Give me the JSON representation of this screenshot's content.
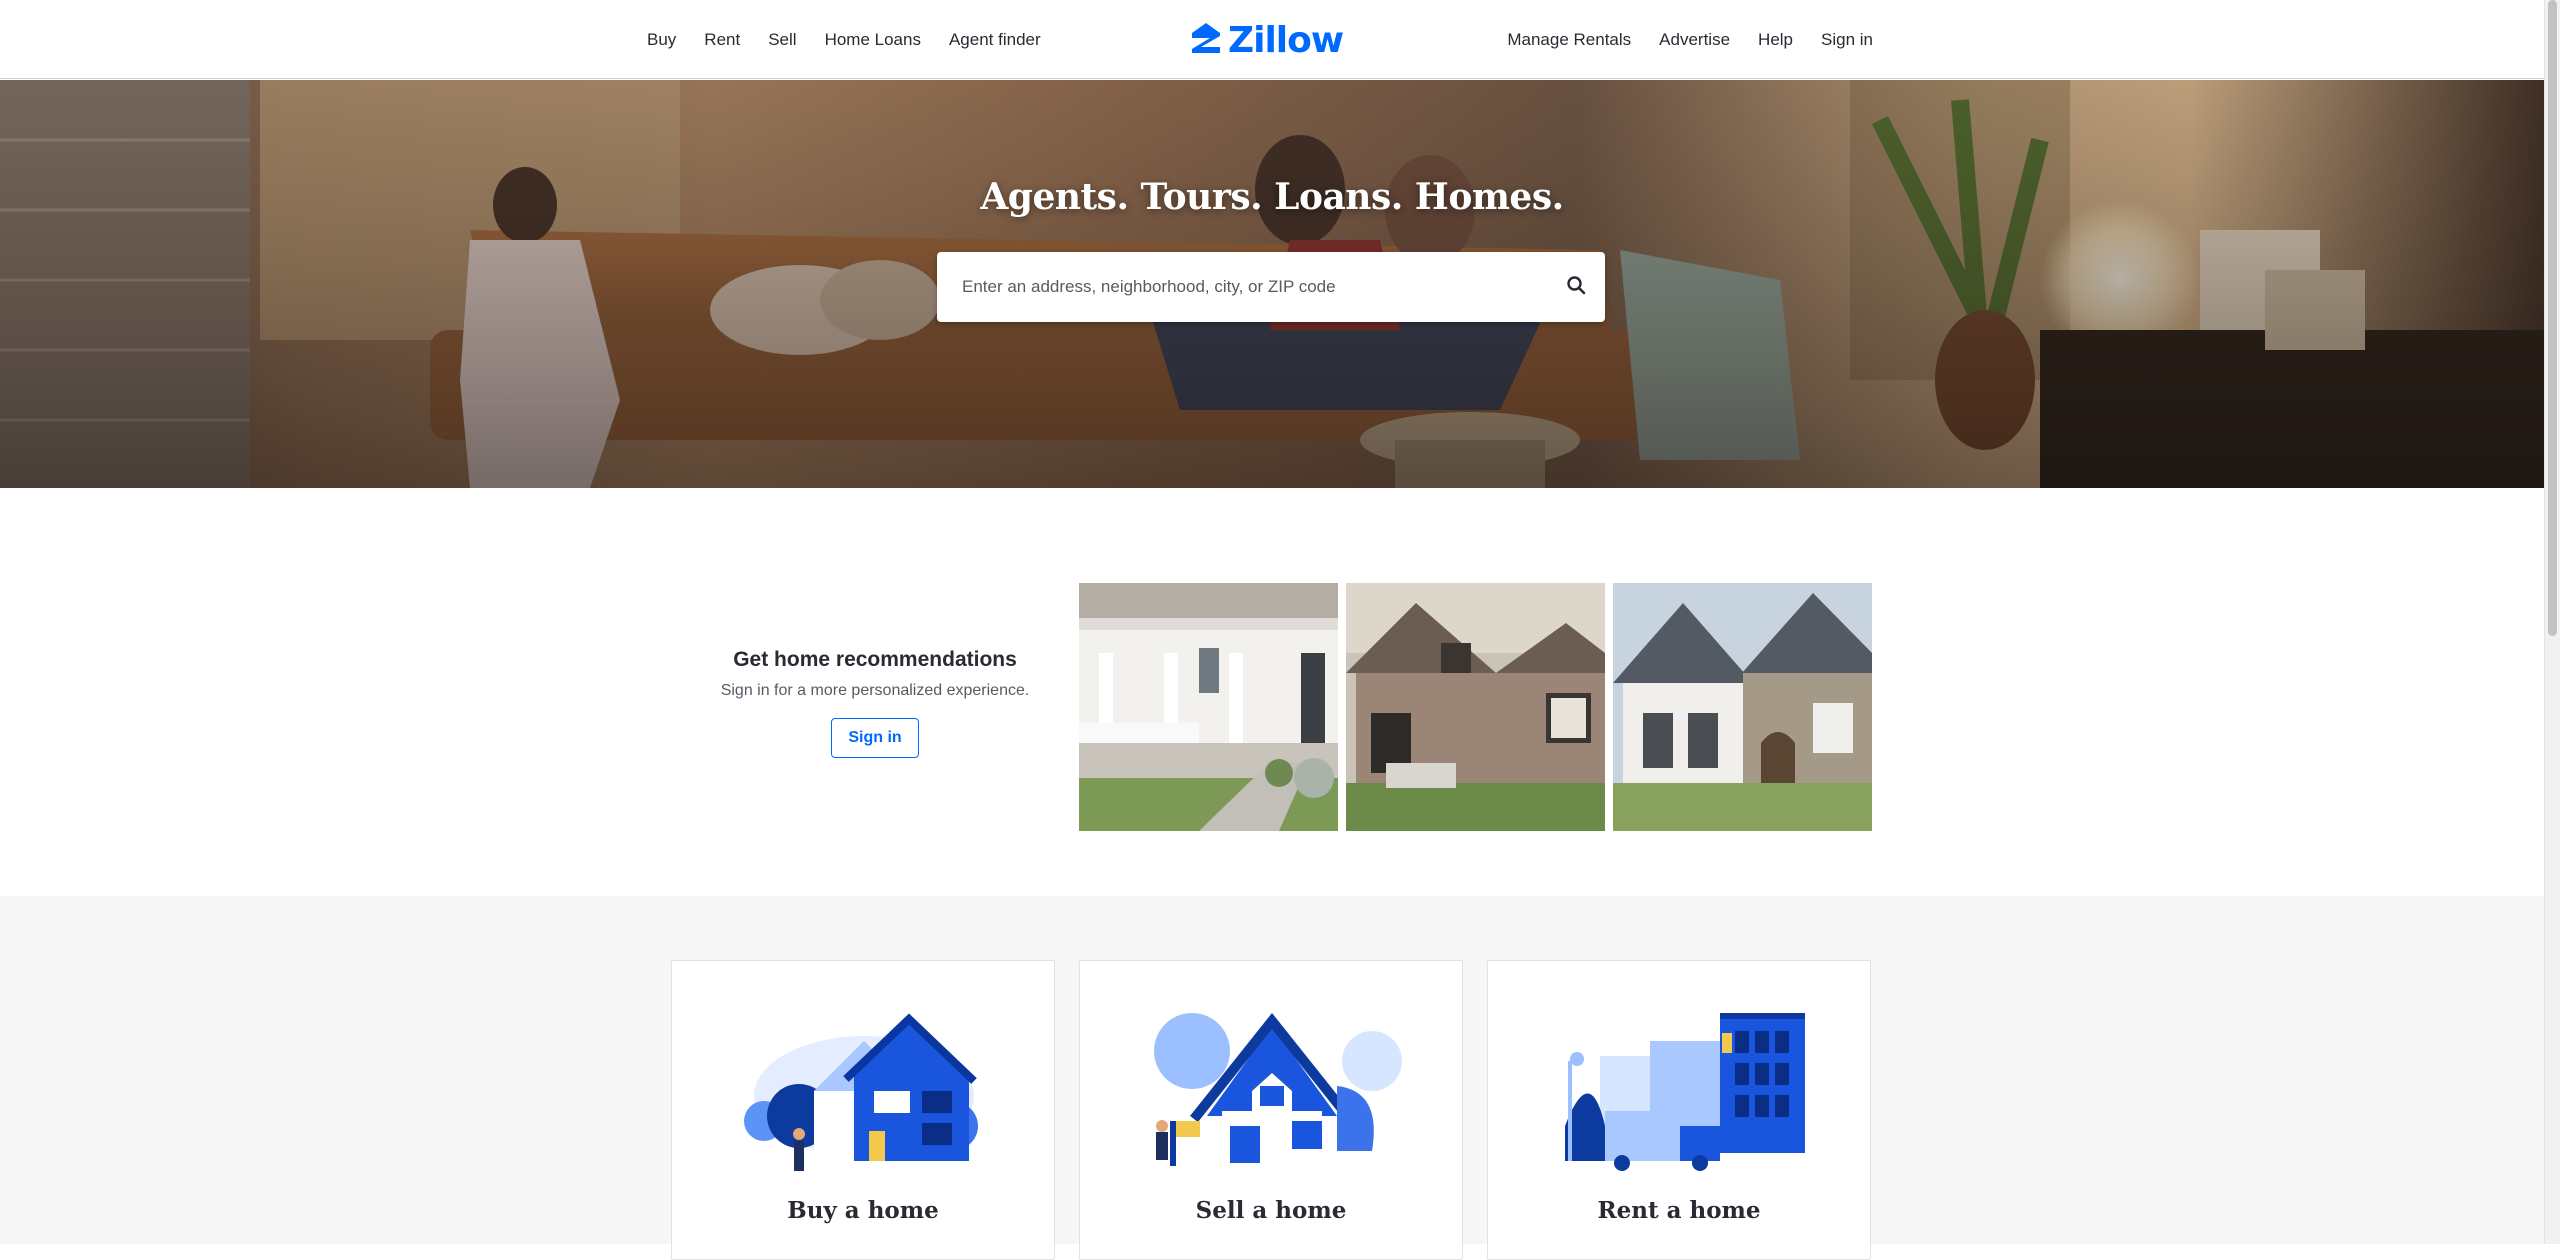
{
  "header": {
    "nav_left": [
      "Buy",
      "Rent",
      "Sell",
      "Home Loans",
      "Agent finder"
    ],
    "nav_right": [
      "Manage Rentals",
      "Advertise",
      "Help",
      "Sign in"
    ],
    "logo_text": "Zillow"
  },
  "hero": {
    "headline": "Agents. Tours. Loans. Homes.",
    "search_placeholder": "Enter an address, neighborhood, city, or ZIP code"
  },
  "recommendations": {
    "title": "Get home recommendations",
    "subtitle": "Sign in for a more personalized experience.",
    "signin_label": "Sign in"
  },
  "cards": [
    {
      "title": "Buy a home"
    },
    {
      "title": "Sell a home"
    },
    {
      "title": "Rent a home"
    }
  ],
  "colors": {
    "brand": "#006aff",
    "text": "#2a2a33",
    "section_bg": "#f6f6f6"
  },
  "icons": {
    "logo": "zillow-z-logo",
    "search": "search-icon"
  }
}
